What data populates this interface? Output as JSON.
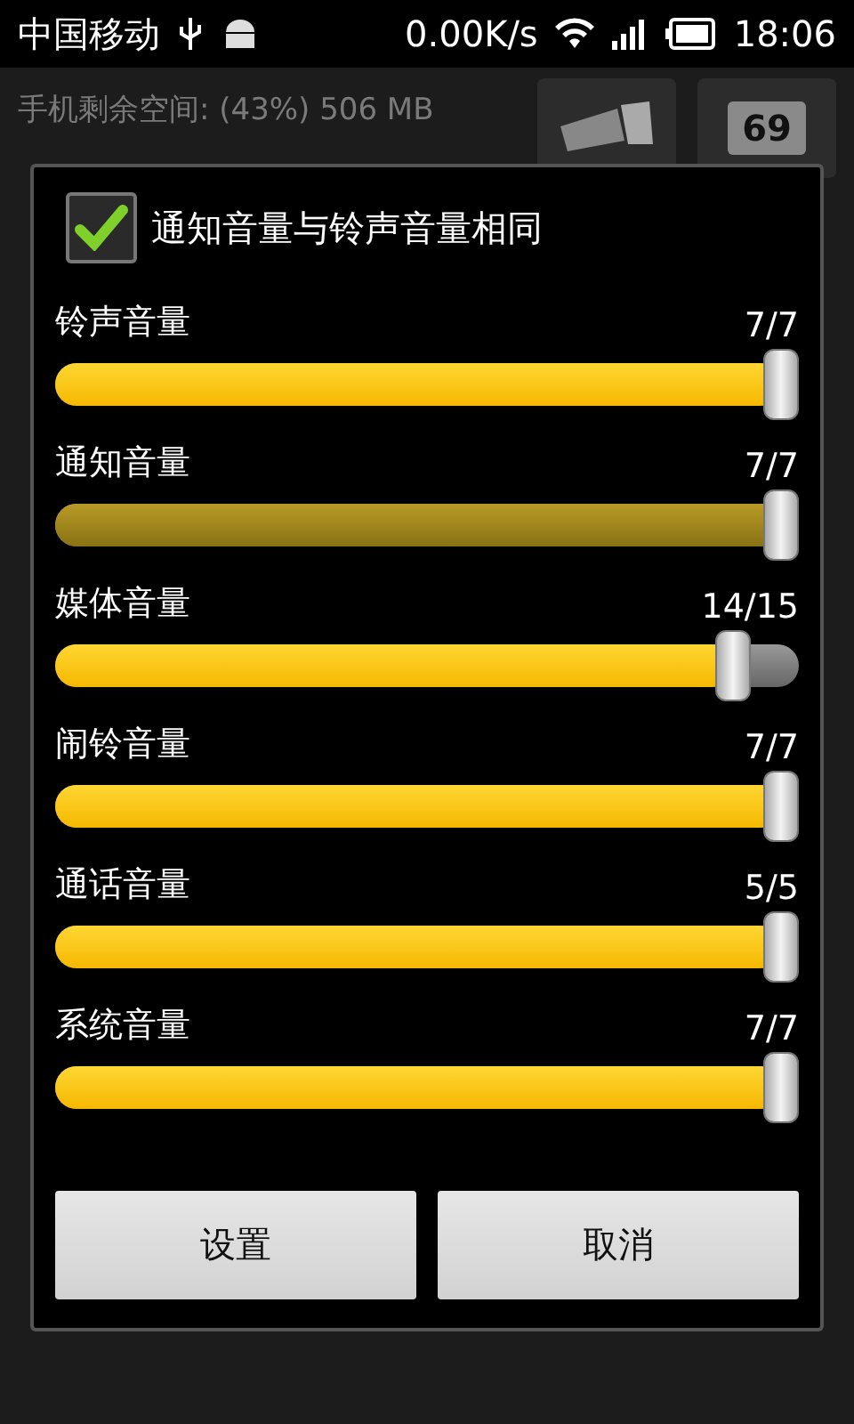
{
  "status_bar": {
    "carrier": "中国移动",
    "speed": "0.00K/s",
    "time": "18:06"
  },
  "background": {
    "storage": "手机剩余空间: (43%) 506 MB",
    "battery_tile": "69"
  },
  "dialog": {
    "checkbox": {
      "label": "通知音量与铃声音量相同",
      "checked": true
    },
    "sliders": [
      {
        "label": "铃声音量",
        "reading": "7/7",
        "level": 1,
        "disabled": false
      },
      {
        "label": "通知音量",
        "reading": "7/7",
        "level": 1,
        "disabled": true
      },
      {
        "label": "媒体音量",
        "reading": "14/15",
        "level": 0.933,
        "disabled": false
      },
      {
        "label": "闹铃音量",
        "reading": "7/7",
        "level": 1,
        "disabled": false
      },
      {
        "label": "通话音量",
        "reading": "5/5",
        "level": 1,
        "disabled": false
      },
      {
        "label": "系统音量",
        "reading": "7/7",
        "level": 1,
        "disabled": false
      }
    ],
    "buttons": [
      "设置",
      "取消"
    ]
  }
}
